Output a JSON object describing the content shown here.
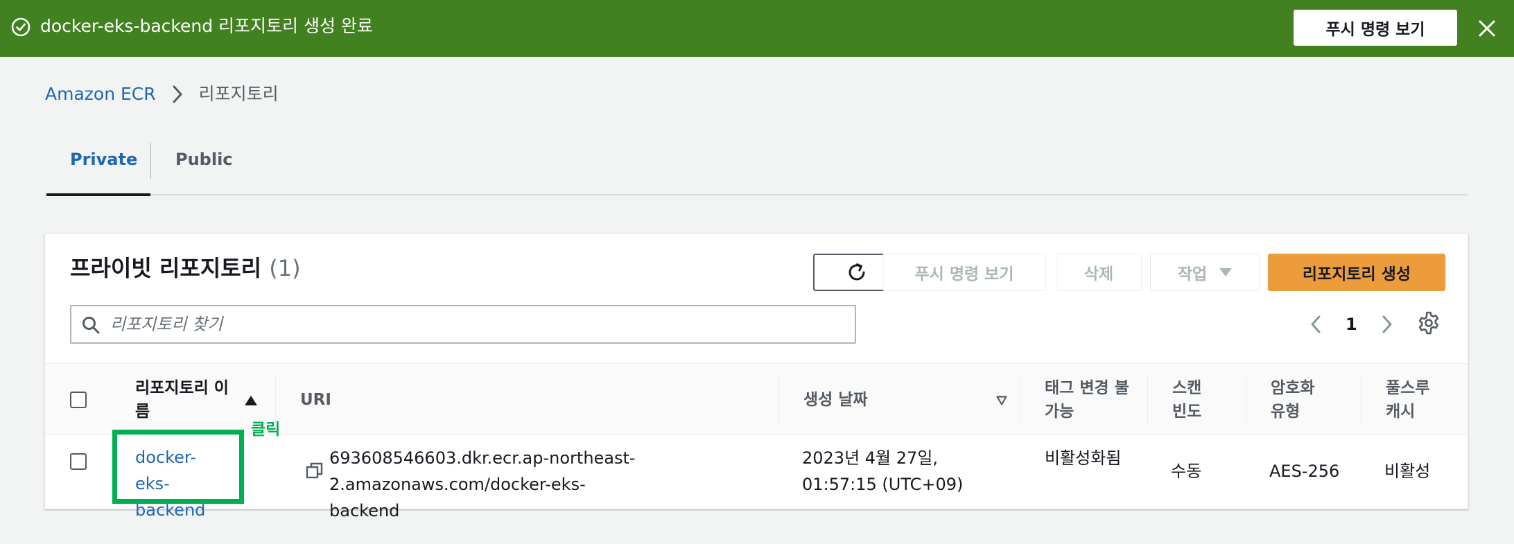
{
  "flash": {
    "message": "docker-eks-backend 리포지토리 생성 완료",
    "push_button": "푸시 명령 보기",
    "color": "#428120"
  },
  "breadcrumb": {
    "root": "Amazon ECR",
    "current": "리포지토리"
  },
  "tabs": [
    {
      "label": "Private",
      "active": true
    },
    {
      "label": "Public",
      "active": false
    }
  ],
  "panel": {
    "title": "프라이빗 리포지토리",
    "count": "(1)",
    "buttons": {
      "push": "푸시 명령 보기",
      "delete": "삭제",
      "actions": "작업",
      "create": "리포지토리 생성"
    },
    "search_placeholder": "리포지토리 찾기",
    "page": "1"
  },
  "table": {
    "headers": {
      "name": "리포지토리 이름",
      "uri": "URI",
      "created": "생성 날짜",
      "tag_immutability": "태그 변경 불가능",
      "scan_frequency": "스캔 빈도",
      "encryption": "암호화 유형",
      "pull_through_cache": "풀스루 캐시"
    },
    "rows": [
      {
        "name": "docker-eks-backend",
        "uri": "693608546603.dkr.ecr.ap-northeast-2.amazonaws.com/docker-eks-backend",
        "created": "2023년 4월 27일, 01:57:15 (UTC+09)",
        "tag_immutability": "비활성화됨",
        "scan_frequency": "수동",
        "encryption": "AES-256",
        "pull_through_cache": "비활성"
      }
    ]
  },
  "annotation": {
    "label": "클릭",
    "color": "#00b050"
  },
  "colors": {
    "accent_orange": "#ec9c3a",
    "link_blue": "#1f66b3"
  },
  "icons": [
    "success-check-icon",
    "close-icon",
    "breadcrumb-chevron-icon",
    "refresh-icon",
    "caret-down-icon",
    "search-icon",
    "prev-page-icon",
    "next-page-icon",
    "settings-gear-icon",
    "sort-ascending-icon",
    "sort-descending-icon",
    "copy-icon"
  ]
}
